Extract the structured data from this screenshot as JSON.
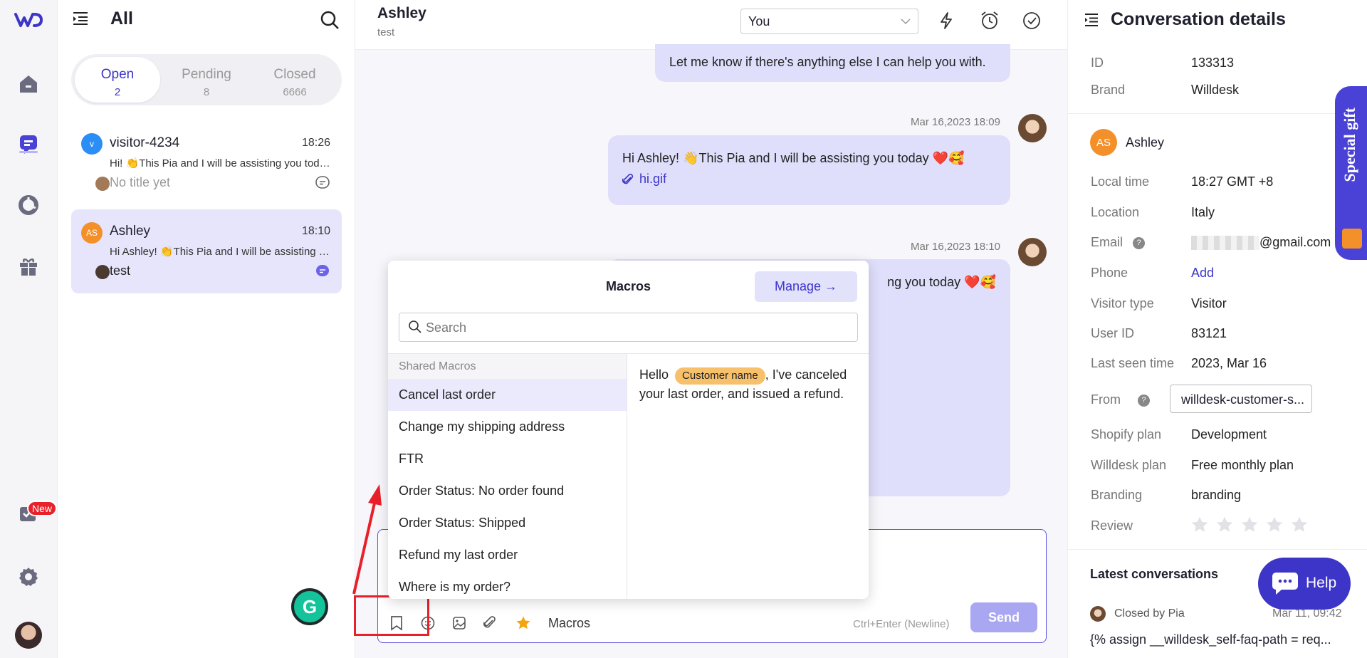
{
  "list": {
    "title": "All",
    "tabs": [
      {
        "label": "Open",
        "count": "2"
      },
      {
        "label": "Pending",
        "count": "8"
      },
      {
        "label": "Closed",
        "count": "6666"
      }
    ],
    "conversations": [
      {
        "avatar": "v",
        "name": "visitor-4234",
        "time": "18:26",
        "preview": "Hi! 👏This Pia and I will be assisting you today",
        "subtitle": "No title yet"
      },
      {
        "avatar": "AS",
        "name": "Ashley",
        "time": "18:10",
        "preview": "Hi Ashley! 👏This Pia and I will be assisting you today",
        "subtitle": "test"
      }
    ]
  },
  "rail": {
    "new_badge": "New"
  },
  "chat": {
    "name": "Ashley",
    "subtitle": "test",
    "assignee": "You",
    "msg0": "Let me know if there's anything else I can help you with.",
    "msg1": {
      "time": "Mar 16,2023 18:09",
      "text": "Hi Ashley! 👋This Pia and I will be assisting you today ❤️🥰",
      "attachment": "hi.gif"
    },
    "msg2": {
      "time": "Mar 16,2023 18:10",
      "text": "ng you today ❤️🥰"
    }
  },
  "macros": {
    "title": "Macros",
    "manage": "Manage →",
    "search_placeholder": "Search",
    "section": "Shared Macros",
    "items": [
      "Cancel last order",
      "Change my shipping address",
      "FTR",
      "Order Status: No order found",
      "Order Status: Shipped",
      "Refund my last order",
      "Where is my order?"
    ],
    "preview_hello": "Hello",
    "preview_tag": "Customer name",
    "preview_rest1": ", I've canceled",
    "preview_rest2": "your last order, and issued a refund."
  },
  "composer": {
    "macros_label": "Macros",
    "hint": "Ctrl+Enter (Newline)",
    "send": "Send",
    "grammarly": "G"
  },
  "details": {
    "title": "Conversation details",
    "rows_top": [
      {
        "label": "ID",
        "value": "133313"
      },
      {
        "label": "Brand",
        "value": "Willdesk"
      }
    ],
    "customer_initials": "AS",
    "customer_name": "Ashley",
    "local_time": {
      "label": "Local time",
      "value": "18:27 GMT +8"
    },
    "location": {
      "label": "Location",
      "value": "Italy"
    },
    "email": {
      "label": "Email",
      "value": "@gmail.com"
    },
    "phone": {
      "label": "Phone",
      "value": "Add"
    },
    "visitor_type": {
      "label": "Visitor type",
      "value": "Visitor"
    },
    "user_id": {
      "label": "User ID",
      "value": "83121"
    },
    "last_seen": {
      "label": "Last seen time",
      "value": "2023, Mar 16"
    },
    "from": {
      "label": "From",
      "value": "willdesk-customer-s..."
    },
    "shopify": {
      "label": "Shopify plan",
      "value": "Development"
    },
    "willdesk": {
      "label": "Willdesk plan",
      "value": "Free monthly plan"
    },
    "branding": {
      "label": "Branding",
      "value": "branding"
    },
    "review": {
      "label": "Review",
      "stars": 0
    },
    "latest_title": "Latest conversations",
    "latest_status": "Closed by Pia",
    "latest_time": "Mar 11, 09:42",
    "latest_text": "{% assign __willdesk_self-faq-path = req...",
    "gift": "Special gift",
    "help": "Help"
  },
  "colors": {
    "accent": "#4a42d6",
    "bubble": "#dfdffc",
    "orange": "#f4902a",
    "annotation": "#e8202a"
  }
}
